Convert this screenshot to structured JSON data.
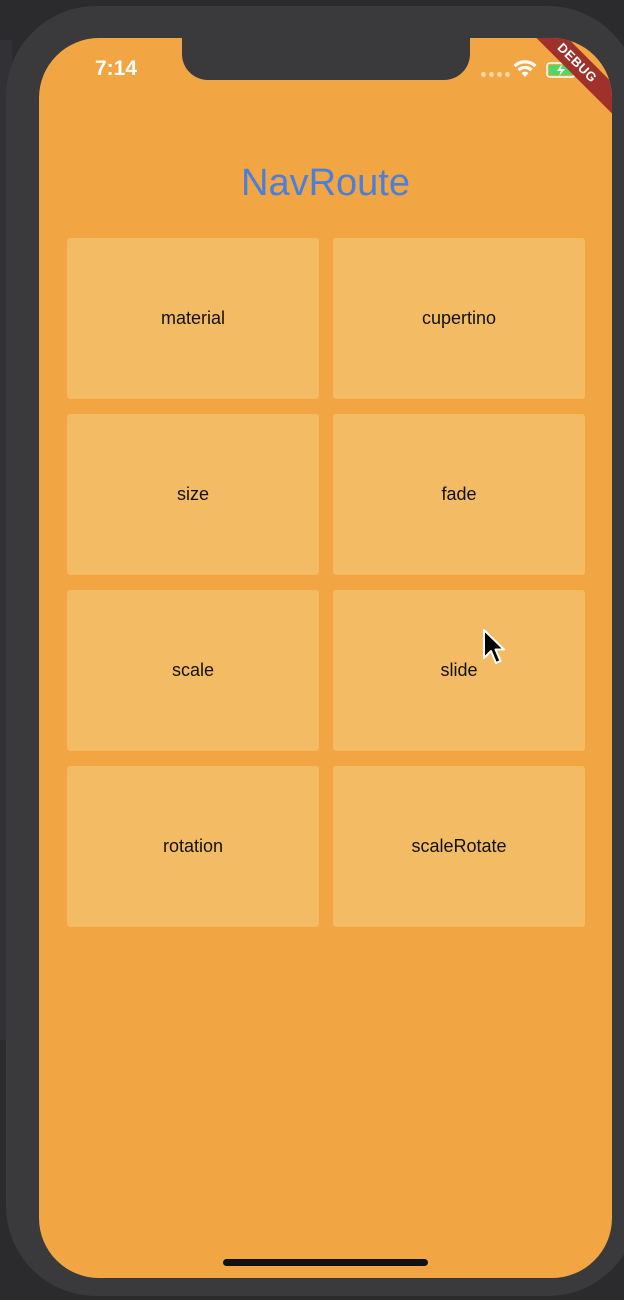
{
  "status_bar": {
    "time": "7:14",
    "debug_label": "DEBUG",
    "icons": [
      "signal-dots-icon",
      "wifi-icon",
      "battery-charging-icon"
    ]
  },
  "page": {
    "title": "NavRoute"
  },
  "grid": {
    "items": [
      {
        "label": "material"
      },
      {
        "label": "cupertino"
      },
      {
        "label": "size"
      },
      {
        "label": "fade"
      },
      {
        "label": "scale"
      },
      {
        "label": "slide"
      },
      {
        "label": "rotation"
      },
      {
        "label": "scaleRotate"
      }
    ]
  },
  "colors": {
    "background": "#f2a643",
    "button": "#f3bb64",
    "title": "#4a7fdc",
    "debug_banner": "#a0302a"
  }
}
